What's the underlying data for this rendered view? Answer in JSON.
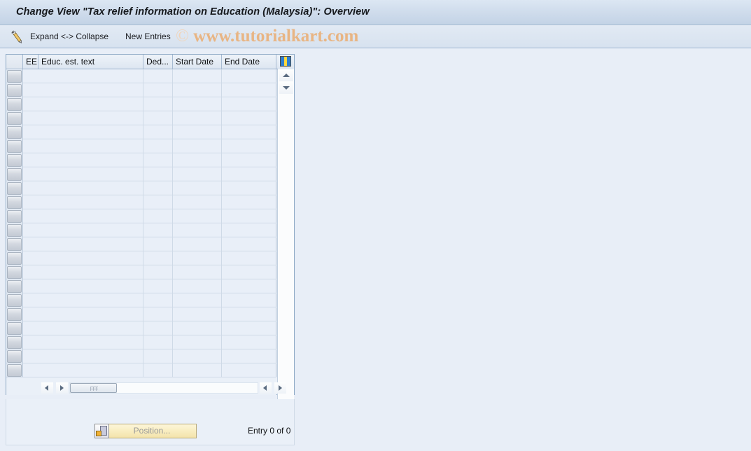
{
  "window": {
    "title": "Change View \"Tax relief information on Education (Malaysia)\": Overview"
  },
  "toolbar": {
    "edit_icon": "pencil-icon",
    "expand_collapse_label": "Expand <-> Collapse",
    "new_entries_label": "New Entries"
  },
  "watermark": {
    "symbol": "©",
    "text": " www.tutorialkart.com",
    "color": "#e8b584"
  },
  "table": {
    "columns": [
      {
        "key": "ee",
        "label": "EE"
      },
      {
        "key": "educ_est_text",
        "label": "Educ. est. text"
      },
      {
        "key": "ded",
        "label": "Ded..."
      },
      {
        "key": "start_date",
        "label": "Start Date"
      },
      {
        "key": "end_date",
        "label": "End Date"
      }
    ],
    "rows": [],
    "empty_row_count": 22,
    "config_icon": "column-config-icon",
    "vertical_scrollbar": {
      "up_icon": "arrow-up-icon",
      "down_icon": "arrow-down-icon"
    },
    "horizontal_scrollbar": {
      "left_icon": "arrow-left-icon",
      "right_icon": "arrow-right-icon"
    }
  },
  "footer": {
    "position_button_label": "Position...",
    "position_button_icon": "position-icon",
    "entry_count_label": "Entry 0 of 0"
  },
  "colors": {
    "app_background": "#e8eef7",
    "title_bar": "#cfdcec",
    "grid_cell": "#e9eff8",
    "button_yellow": "#f8ecbe",
    "border_blue": "#8ba7c4"
  }
}
